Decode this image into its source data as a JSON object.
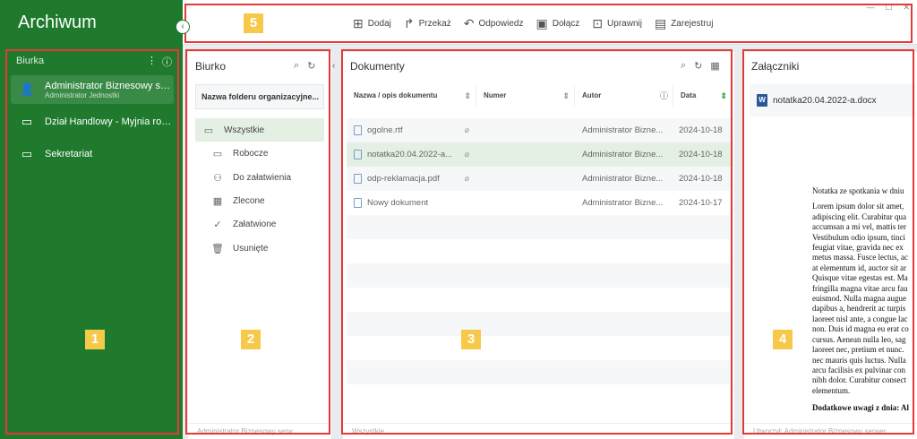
{
  "app": {
    "title": "Archiwum"
  },
  "sidebar": {
    "section": "Biurka",
    "items": [
      {
        "label": "Administrator Biznesowy ser...",
        "sub": "Administrator Jednostki",
        "icon": "user-icon"
      },
      {
        "label": "Dział Handlowy - Myjnia rob...",
        "icon": "inbox-icon"
      },
      {
        "label": "Sekretariat",
        "icon": "inbox-icon"
      }
    ]
  },
  "toolbar": {
    "buttons": [
      {
        "label": "Dodaj",
        "icon": "plus-square-icon"
      },
      {
        "label": "Przekaż",
        "icon": "forward-icon"
      },
      {
        "label": "Odpowiedz",
        "icon": "reply-icon"
      },
      {
        "label": "Dołącz",
        "icon": "briefcase-icon"
      },
      {
        "label": "Uprawnij",
        "icon": "lock-icon"
      },
      {
        "label": "Zarejestruj",
        "icon": "register-icon"
      }
    ]
  },
  "biurko": {
    "title": "Biurko",
    "folder_header": "Nazwa folderu organizacyjne...",
    "folders": [
      {
        "label": "Wszystkie",
        "icon": "folder-icon"
      },
      {
        "label": "Robocze",
        "icon": "inbox-icon"
      },
      {
        "label": "Do załatwienia",
        "icon": "tasks-icon"
      },
      {
        "label": "Zlecone",
        "icon": "calendar-icon"
      },
      {
        "label": "Załatwione",
        "icon": "check-circle-icon"
      },
      {
        "label": "Usunięte",
        "icon": "trash-icon"
      }
    ],
    "footer": "Administrator Biznesowy serw..."
  },
  "dokumenty": {
    "title": "Dokumenty",
    "columns": [
      "Nazwa / opis dokumentu",
      "Numer",
      "Autor",
      "Data"
    ],
    "rows": [
      {
        "name": "ogolne.rtf",
        "numer": "",
        "autor": "Administrator Bizne...",
        "data": "2024-10-18",
        "attach": true
      },
      {
        "name": "notatka20.04.2022-a...",
        "numer": "",
        "autor": "Administrator Bizne...",
        "data": "2024-10-18",
        "attach": true
      },
      {
        "name": "odp-reklamacja.pdf",
        "numer": "",
        "autor": "Administrator Bizne...",
        "data": "2024-10-18",
        "attach": true
      },
      {
        "name": "Nowy dokument",
        "numer": "",
        "autor": "Administrator Bizne...",
        "data": "2024-10-17",
        "attach": false
      }
    ],
    "footer": "Wszystkie"
  },
  "zalaczniki": {
    "title": "Załączniki",
    "file": "notatka20.04.2022-a.docx",
    "preview": {
      "heading": "Notatka ze spotkania w dniu",
      "lines": [
        "Lorem ipsum dolor sit amet,",
        "adipiscing elit. Curabitur qua",
        "accumsan a mi vel, mattis ter",
        "Vestibulum odio ipsum, tinci",
        "feugiat vitae, gravida nec ex",
        "metus massa. Fusce lectus, ac",
        "at elementum id, auctor sit ar",
        "Quisque vitae egestas est. Ma",
        "fringilla magna vitae arcu fau",
        "euismod. Nulla magna augue",
        "dapibus a, hendrerit ac turpis",
        "laoreet nisl ante, a congue lac",
        "non. Duis id magna eu erat co",
        "cursus. Aenean nulla leo, sag",
        "laoreet nec, pretium et nunc.",
        "nec mauris quis luctus. Nulla",
        "arcu facilisis ex pulvinar con",
        "nibh dolor. Curabitur consect",
        "elementum."
      ],
      "bold_line": "Dodatkowe uwagi z dnia: Al"
    },
    "footer": "Utworzył: Administrator Biznesowy serwer"
  },
  "annotations": [
    "1",
    "2",
    "3",
    "4",
    "5"
  ]
}
